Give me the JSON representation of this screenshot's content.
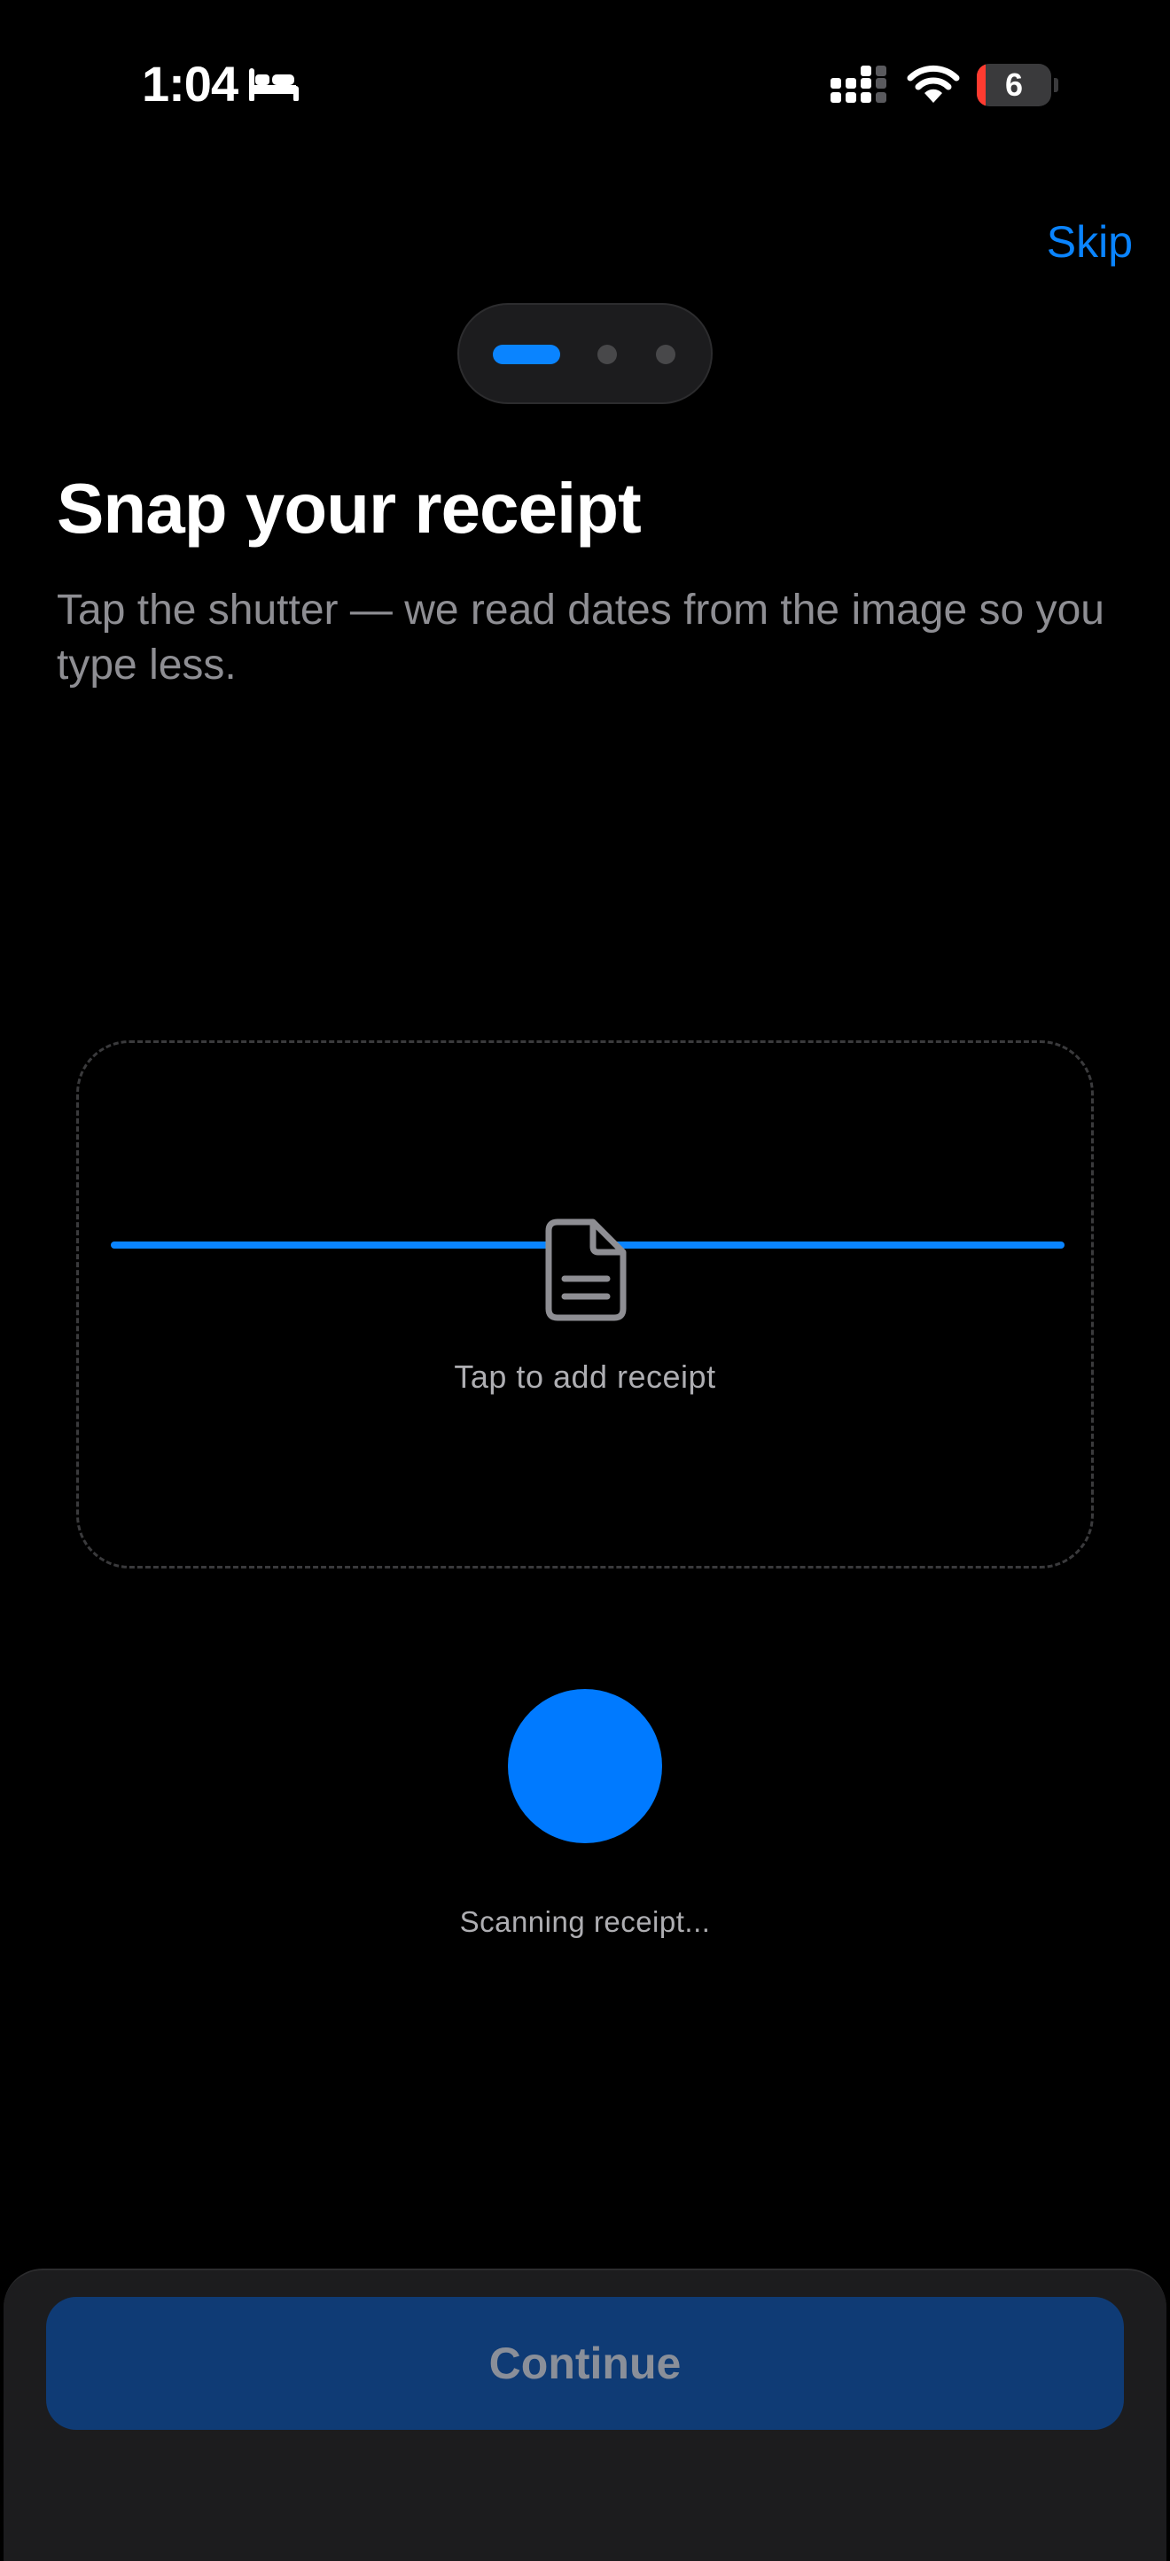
{
  "status_bar": {
    "time": "1:04",
    "battery_level": "6",
    "icons": [
      "sleep-icon",
      "cellular-signal-icon",
      "wifi-icon",
      "battery-icon"
    ]
  },
  "header": {
    "skip_label": "Skip",
    "pages": {
      "current": 1,
      "total": 3
    }
  },
  "main": {
    "title": "Snap your receipt",
    "subtitle": "Tap the shutter — we read dates from the image so you type less.",
    "dropzone": {
      "icon": "document-icon",
      "label": "Tap to add receipt"
    },
    "shutter": {
      "icon": "shutter-button"
    },
    "scan_status": "Scanning receipt..."
  },
  "footer": {
    "continue_label": "Continue"
  },
  "colors": {
    "accent": "#0a84ff",
    "shutter": "#007aff",
    "background": "#000000",
    "panel": "#1c1c1e",
    "continue_disabled": "#0f3b75",
    "battery_low": "#ff3b30"
  }
}
